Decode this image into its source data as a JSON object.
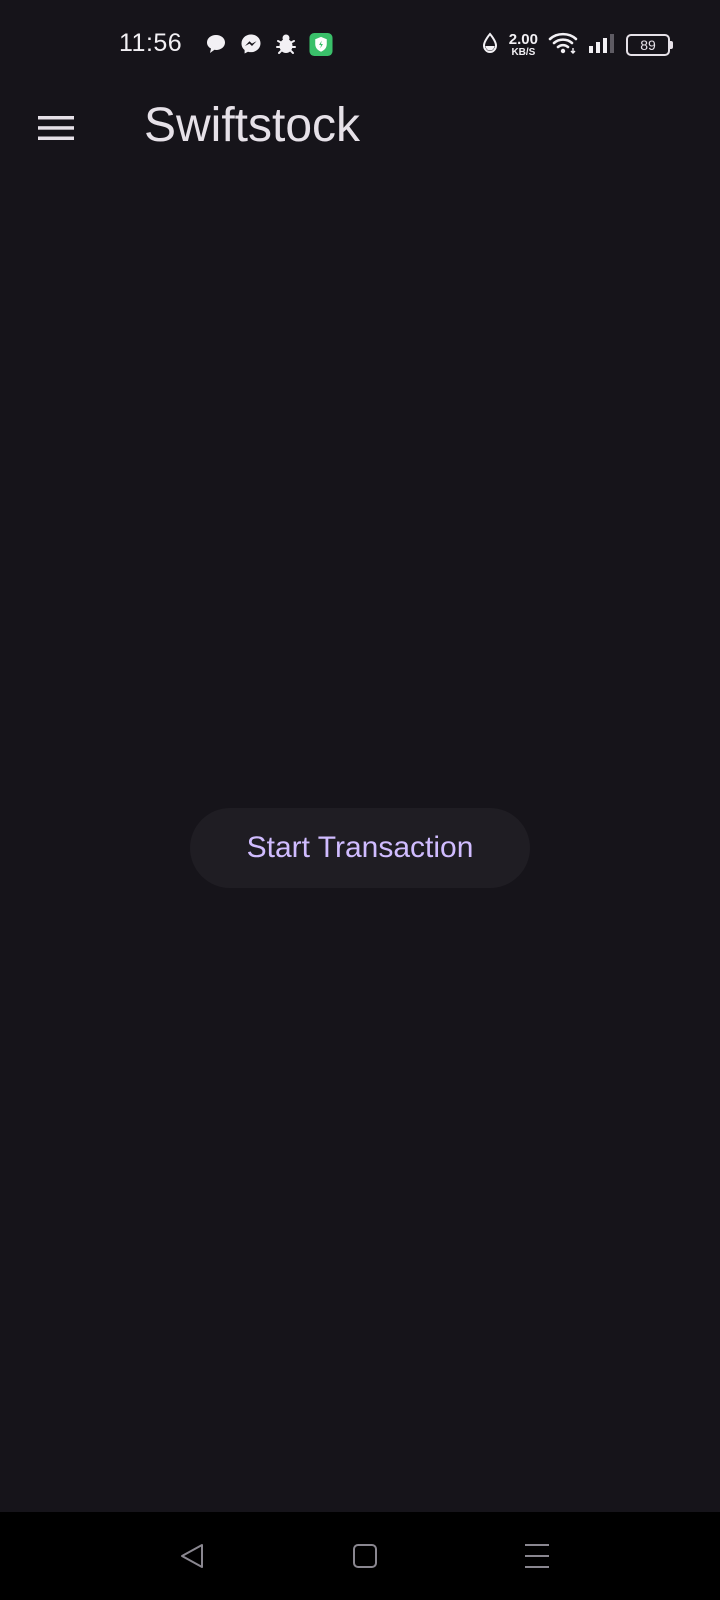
{
  "status_bar": {
    "time": "11:56",
    "net_speed_value": "2.00",
    "net_speed_unit": "KB/S",
    "battery_level": "89",
    "notification_icons": [
      "chat-bubble-icon",
      "messenger-icon",
      "bug-icon",
      "shield-app-icon"
    ],
    "system_icons": [
      "data-saver-icon",
      "wifi-icon",
      "signal-icon",
      "battery-icon"
    ]
  },
  "app_bar": {
    "title": "Swiftstock",
    "menu_icon": "hamburger-menu-icon"
  },
  "main": {
    "start_button_label": "Start Transaction"
  },
  "nav_bar": {
    "buttons": [
      "back-icon",
      "home-icon",
      "recents-icon"
    ]
  },
  "colors": {
    "background": "#16141a",
    "accent": "#d0bcff",
    "button_surface": "#1f1d23",
    "title_text": "#e6e1e8",
    "nav_background": "#000000",
    "shield_app_green": "#3ac06a"
  }
}
